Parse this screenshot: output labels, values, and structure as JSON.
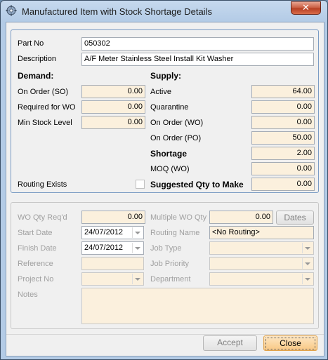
{
  "window": {
    "title": "Manufactured Item with Stock Shortage Details",
    "close_glyph": "✕"
  },
  "item": {
    "part_no_label": "Part No",
    "part_no": "050302",
    "description_label": "Description",
    "description": "A/F Meter Stainless Steel Install Kit Washer"
  },
  "demand": {
    "heading": "Demand:",
    "on_order_so_label": "On Order (SO)",
    "on_order_so": "0.00",
    "required_for_wo_label": "Required for WO",
    "required_for_wo": "0.00",
    "min_stock_label": "Min Stock Level",
    "min_stock": "0.00"
  },
  "supply": {
    "heading": "Supply:",
    "active_label": "Active",
    "active": "64.00",
    "quarantine_label": "Quarantine",
    "quarantine": "0.00",
    "on_order_wo_label": "On Order (WO)",
    "on_order_wo": "0.00",
    "on_order_po_label": "On Order (PO)",
    "on_order_po": "50.00",
    "shortage_label": "Shortage",
    "shortage": "2.00",
    "moq_label": "MOQ (WO)",
    "moq": "0.00",
    "suggested_label": "Suggested Qty to Make",
    "suggested": "0.00"
  },
  "routing_exists_label": "Routing Exists",
  "work_order": {
    "wo_qty_label": "WO Qty Req'd",
    "wo_qty": "0.00",
    "multiple_wo_label": "Multiple WO Qty",
    "multiple_wo": "0.00",
    "dates_button": "Dates",
    "start_date_label": "Start Date",
    "start_date": "24/07/2012",
    "routing_name_label": "Routing Name",
    "routing_name": "<No Routing>",
    "finish_date_label": "Finish Date",
    "finish_date": "24/07/2012",
    "job_type_label": "Job Type",
    "job_type": "",
    "reference_label": "Reference",
    "reference": "",
    "job_priority_label": "Job Priority",
    "job_priority": "",
    "project_no_label": "Project No",
    "project_no": "",
    "department_label": "Department",
    "department": "",
    "notes_label": "Notes",
    "notes": ""
  },
  "buttons": {
    "accept": "Accept",
    "close": "Close"
  }
}
